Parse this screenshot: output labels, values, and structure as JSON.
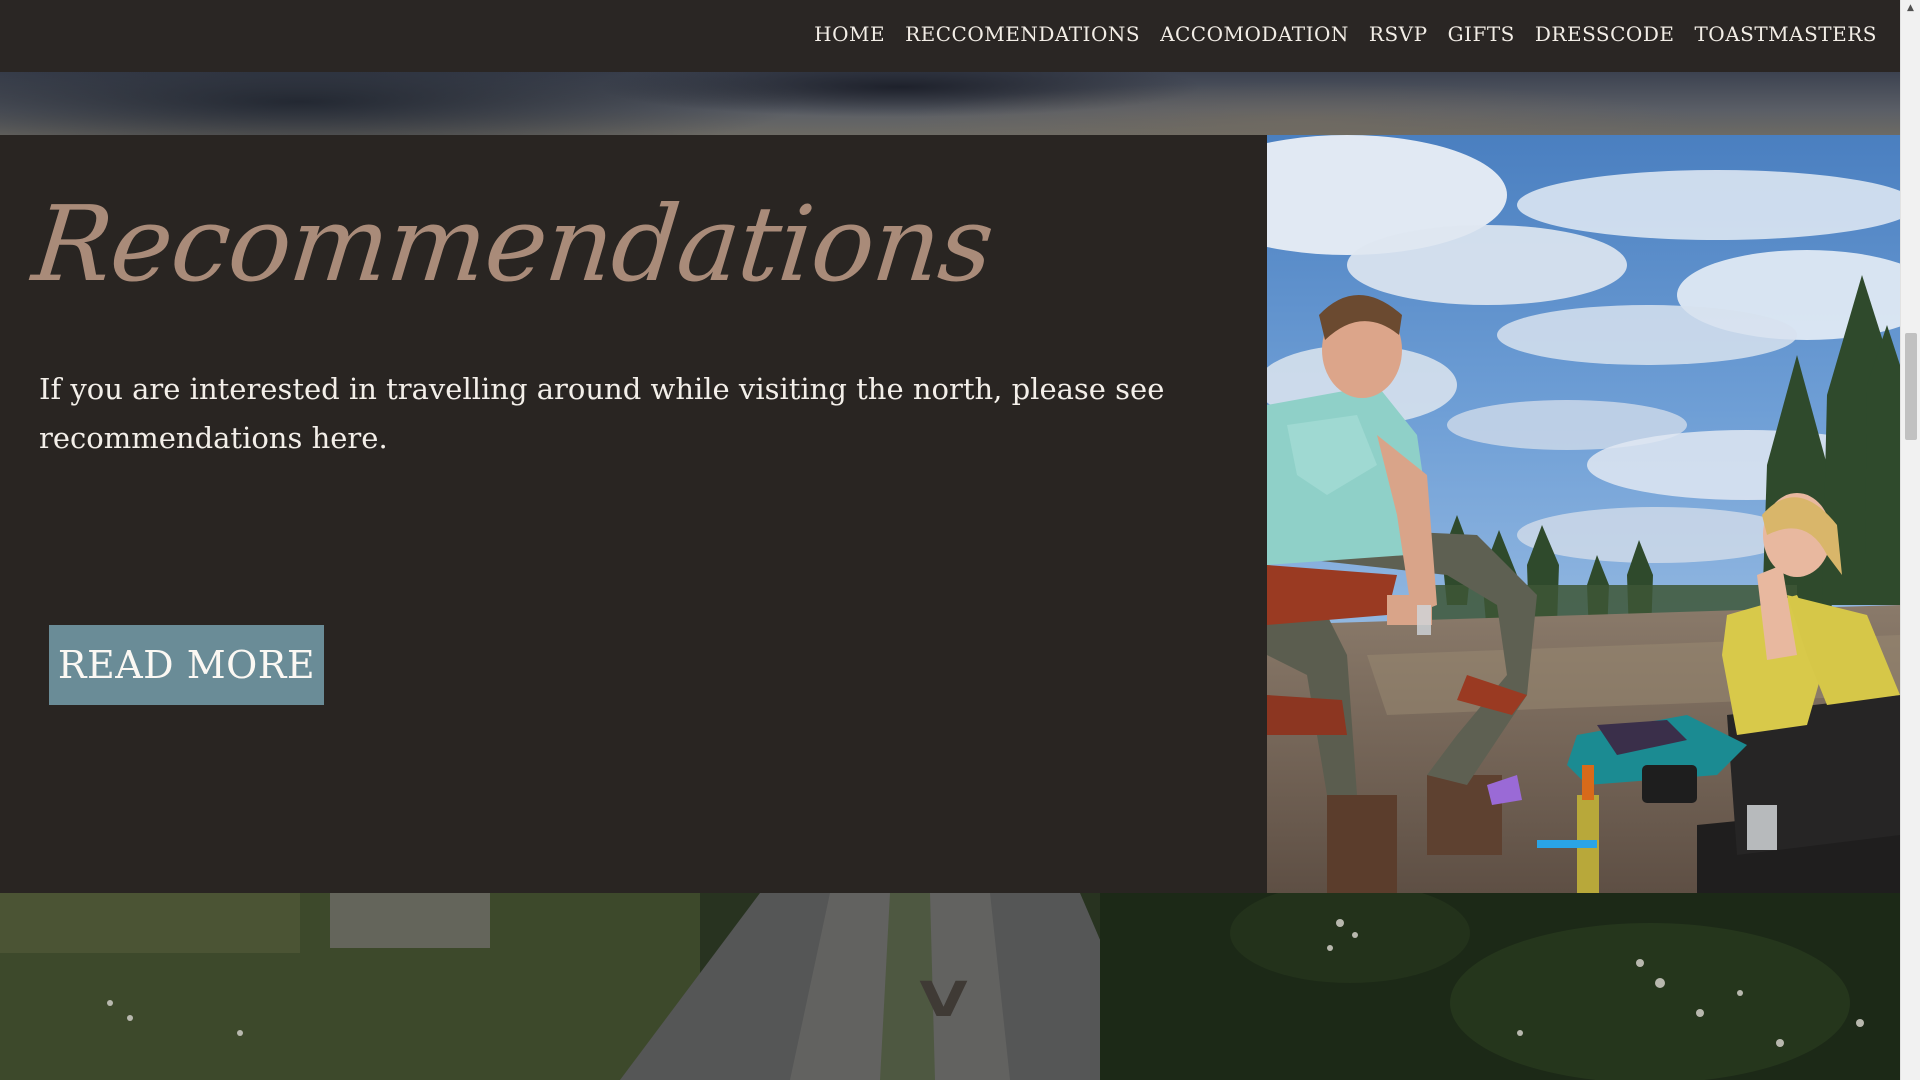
{
  "nav": {
    "items": [
      {
        "label": "HOME"
      },
      {
        "label": "RECCOMENDATIONS"
      },
      {
        "label": "ACCOMODATION"
      },
      {
        "label": "RSVP"
      },
      {
        "label": "GIFTS"
      },
      {
        "label": "DRESSCODE"
      },
      {
        "label": "TOASTMASTERS"
      }
    ]
  },
  "section": {
    "heading": "Recommendations",
    "body": "If you are interested in travelling around while visiting the north, please see recommendations here.",
    "button_label": "READ MORE",
    "heading_color": "#a98b79",
    "button_color": "#6a8c97",
    "background_color": "#292522"
  },
  "photo": {
    "icon": "photo-two-people-picnic"
  },
  "scroll_hint": {
    "glyph": "V",
    "icon": "chevron-down-icon"
  },
  "scrollbar": {
    "up_glyph": "▲",
    "position_fraction": 0.31
  }
}
